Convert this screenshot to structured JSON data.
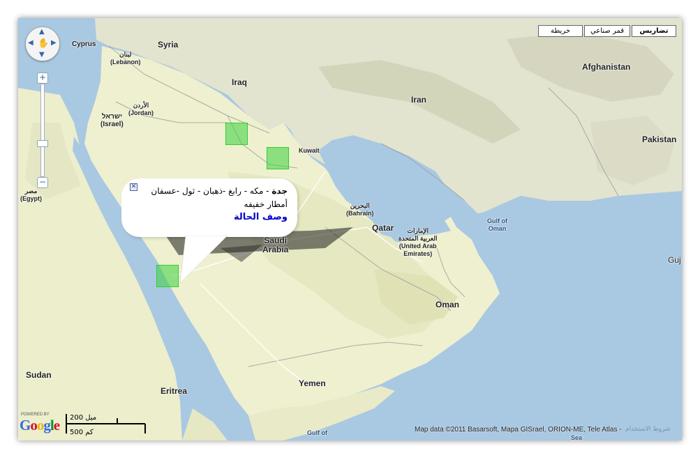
{
  "map_types": [
    {
      "label": "تضاريس",
      "active": true
    },
    {
      "label": "قمر صناعي",
      "active": false
    },
    {
      "label": "خريطة",
      "active": false
    }
  ],
  "controls": {
    "zoom_in": "+",
    "zoom_out": "−"
  },
  "labels": {
    "cyprus": "Cyprus",
    "syria": "Syria",
    "lebanon": "لبنان\n(Lebanon)",
    "iraq": "Iraq",
    "iran": "Iran",
    "afghanistan": "Afghanistan",
    "jordan": "الأردن\n(Jordan)",
    "israel": "ישראל\n(Israel)",
    "kuwait": "Kuwait",
    "pakistan": "Pakistan",
    "egypt": "مصر\n(Egypt)",
    "bahrain": "البحرين\n(Bahrain)",
    "qatar": "Qatar",
    "gulf_of_oman": "Gulf of\nOman",
    "uae": "الإمارات\nالعربية المتحدة\n(United Arab\nEmirates)",
    "saudi": "Saudi\nArabia",
    "oman": "Oman",
    "sudan": "Sudan",
    "yemen": "Yemen",
    "eritrea": "Eritrea",
    "gulf_bottom": "Gulf of",
    "arabian_sea": "Sea",
    "guj": "Guj"
  },
  "info_window": {
    "title": "جدة",
    "text": " - مكه - رابغ -ذهبان - ثول -عسفان",
    "line2": "أمطار خفيفه",
    "link": "وصف الحالة",
    "close": "✕"
  },
  "attribution": "Map data ©2011 Basarsoft, Mapa GISrael, ORION-ME, Tele Atlas -",
  "terms": "شروط الاستخدام",
  "powered_by": "POWERED BY",
  "google": [
    "G",
    "o",
    "o",
    "g",
    "l",
    "e"
  ],
  "google_colors": [
    "#3369e8",
    "#d50f25",
    "#eeb211",
    "#3369e8",
    "#009925",
    "#d50f25"
  ],
  "scale": {
    "upper": "200 ميل",
    "lower": "500 كم"
  }
}
